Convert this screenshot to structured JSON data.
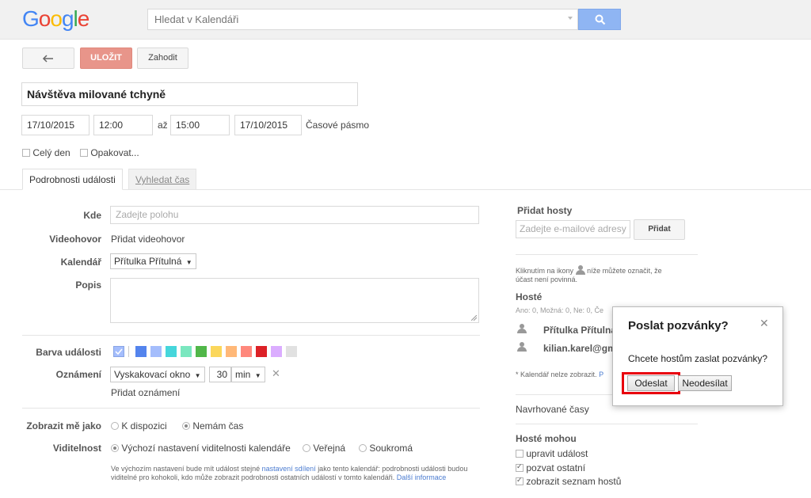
{
  "brand": {
    "letters": [
      "G",
      "o",
      "o",
      "g",
      "l",
      "e"
    ],
    "colors": [
      "#4285f4",
      "#ea4335",
      "#fbbc05",
      "#4285f4",
      "#34a853",
      "#ea4335"
    ]
  },
  "search": {
    "placeholder": "Hledat v Kalendáři"
  },
  "toolbar": {
    "save_label": "ULOŽIT",
    "discard_label": "Zahodit"
  },
  "event": {
    "title": "Návštěva milované tchyně",
    "start_date": "17/10/2015",
    "start_time": "12:00",
    "to_label": "až",
    "end_time": "15:00",
    "end_date": "17/10/2015",
    "timezone_link": "Časové pásmo",
    "all_day_label": "Celý den",
    "repeat_label": "Opakovat..."
  },
  "tabs": {
    "details": "Podrobnosti události",
    "find_time": "Vyhledat čas"
  },
  "details": {
    "where_label": "Kde",
    "where_placeholder": "Zadejte polohu",
    "video_label": "Videohovor",
    "video_link": "Přidat videohovor",
    "calendar_label": "Kalendář",
    "calendar_value": "Přítulka Přítulná",
    "description_label": "Popis",
    "color_label": "Barva události",
    "colors": [
      "#a4bdfc",
      "#7ae7bf",
      "#5484ed",
      "#a4bdfc",
      "#46d6db",
      "#7ae7bf",
      "#51b749",
      "#fbd75b",
      "#ffb878",
      "#ff887c",
      "#dc2127",
      "#dbadff",
      "#e1e1e1"
    ],
    "notification_label": "Oznámení",
    "notification_type": "Vyskakovací okno",
    "notification_value": "30",
    "notification_unit": "min",
    "add_notification_link": "Přidat oznámení",
    "show_as_label": "Zobrazit mě jako",
    "show_as_available": "K dispozici",
    "show_as_busy": "Nemám čas",
    "visibility_label": "Viditelnost",
    "visibility_default": "Výchozí nastavení viditelnosti kalendáře",
    "visibility_public": "Veřejná",
    "visibility_private": "Soukromá",
    "visibility_note_1": "Ve výchozím nastavení bude mít událost stejné",
    "visibility_note_link": "nastavení sdílení",
    "visibility_note_2": "jako tento kalendář: podrobnosti události budou viditelné pro kohokoli, kdo může zobrazit podrobnosti ostatních událostí v tomto kalendáři.",
    "visibility_more_link": "Další informace"
  },
  "guests": {
    "add_title": "Přidat hosty",
    "add_placeholder": "Zadejte e-mailové adresy h",
    "add_button": "Přidat",
    "hint_1": "Kliknutím na ikony",
    "hint_2": "níže můžete označit, že",
    "hint_3": "účast není povinná.",
    "title": "Hosté",
    "summary": "Ano: 0, Možná: 0, Ne: 0, Če",
    "list": [
      "Přítulka Přítulná",
      "kilian.karel@gma"
    ],
    "note": "* Kalendář nelze zobrazit.",
    "note_link": "P",
    "suggested_link": "Navrhované časy",
    "can_title": "Hosté mohou",
    "can_modify": "upravit událost",
    "can_invite": "pozvat ostatní",
    "can_see": "zobrazit seznam hostů"
  },
  "dialog": {
    "title": "Poslat pozvánky?",
    "message": "Chcete hostům zaslat pozvánky?",
    "send": "Odeslat",
    "dont_send": "Neodesílat",
    "highlight_color": "#e8000d"
  }
}
